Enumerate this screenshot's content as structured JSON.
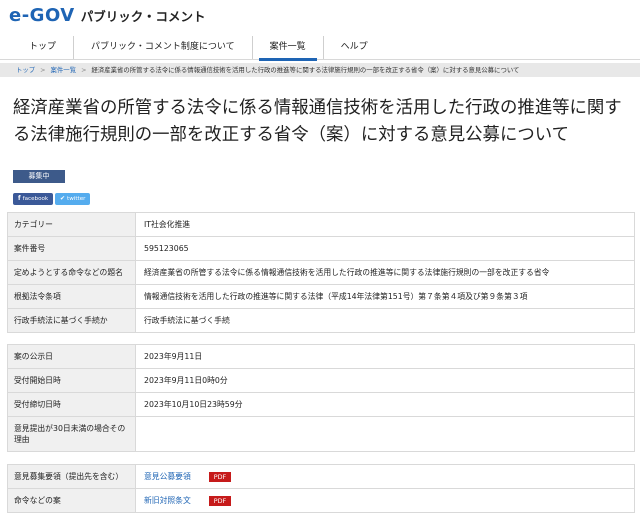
{
  "header": {
    "logo_mark": "e-GOV",
    "logo_sub": "パブリック・コメント"
  },
  "nav": {
    "items": [
      {
        "label": "トップ"
      },
      {
        "label": "パブリック・コメント制度について"
      },
      {
        "label": "案件一覧"
      },
      {
        "label": "ヘルプ"
      }
    ]
  },
  "breadcrumb": {
    "items": [
      "トップ",
      "案件一覧",
      "経済産業省の所管する法令に係る情報通信技術を活用した行政の推進等に関する法律施行規則の一部を改正する省令（案）に対する意見公募について"
    ]
  },
  "title": "経済産業省の所管する法令に係る情報通信技術を活用した行政の推進等に関する法律施行規則の一部を改正する省令（案）に対する意見公募について",
  "status_badge": "募集中",
  "share": {
    "facebook": "facebook",
    "twitter": "twitter"
  },
  "details": [
    {
      "label": "カテゴリー",
      "value": "IT社会化推進"
    },
    {
      "label": "案件番号",
      "value": "595123065"
    },
    {
      "label": "定めようとする命令などの題名",
      "value": "経済産業省の所管する法令に係る情報通信技術を活用した行政の推進等に関する法律施行規則の一部を改正する省令"
    },
    {
      "label": "根拠法令条項",
      "value": "情報通信技術を活用した行政の推進等に関する法律（平成14年法律第151号）第７条第４項及び第９条第３項"
    },
    {
      "label": "行政手続法に基づく手続か",
      "value": "行政手続法に基づく手続"
    }
  ],
  "dates": [
    {
      "label": "案の公示日",
      "value": "2023年9月11日"
    },
    {
      "label": "受付開始日時",
      "value": "2023年9月11日0時0分"
    },
    {
      "label": "受付締切日時",
      "value": "2023年10月10日23時59分"
    },
    {
      "label": "意見提出が30日未満の場合その理由",
      "value": ""
    }
  ],
  "documents": [
    {
      "label": "意見募集要領（提出先を含む）",
      "link": "意見公募要領",
      "badge": "PDF"
    },
    {
      "label": "命令などの案",
      "link": "新旧対照条文",
      "badge": "PDF"
    }
  ]
}
